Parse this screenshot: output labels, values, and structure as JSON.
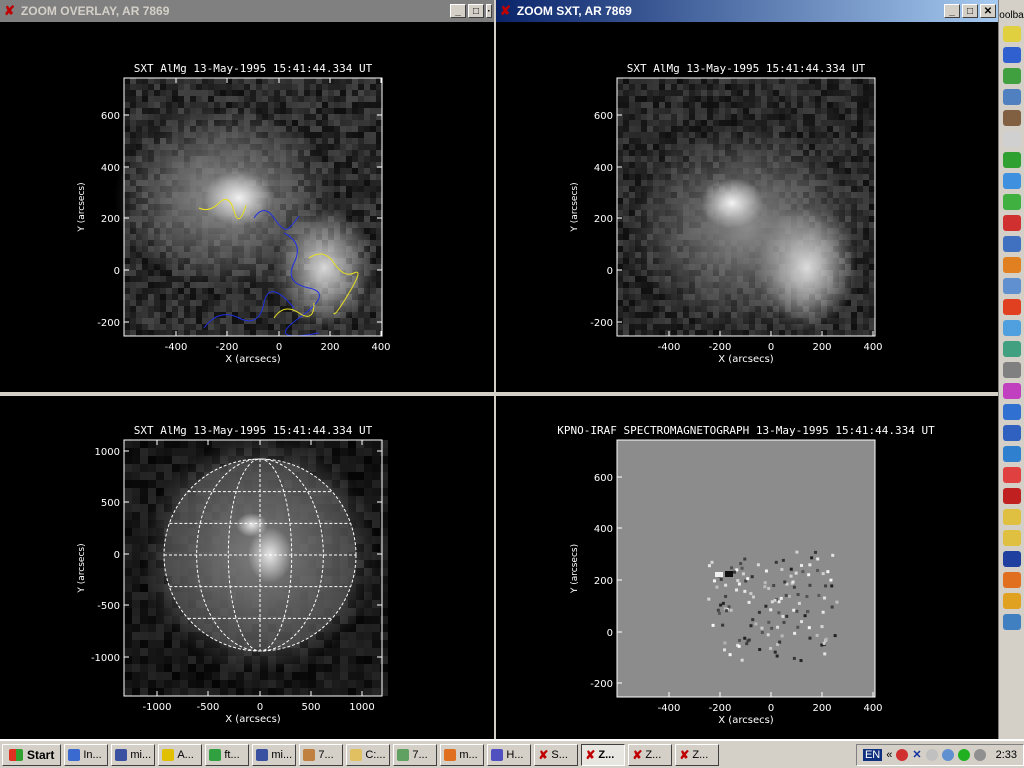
{
  "windows": {
    "left": {
      "title": "ZOOM OVERLAY, AR 7869"
    },
    "right": {
      "title": "ZOOM SXT, AR 7869"
    }
  },
  "panels": {
    "overlay": {
      "title": "SXT AlMg 13-May-1995 15:41:44.334 UT",
      "xlabel": "X (arcsecs)",
      "ylabel": "Y (arcsecs)",
      "xticks": [
        "-400",
        "-200",
        "0",
        "200",
        "400"
      ],
      "yticks": [
        "600",
        "400",
        "200",
        "0",
        "-200"
      ]
    },
    "sxt_zoom": {
      "title": "SXT AlMg 13-May-1995 15:41:44.334 UT",
      "xlabel": "X (arcsecs)",
      "ylabel": "Y (arcsecs)",
      "xticks": [
        "-400",
        "-200",
        "0",
        "200",
        "400"
      ],
      "yticks": [
        "600",
        "400",
        "200",
        "0",
        "-200"
      ]
    },
    "full_disk": {
      "title": "SXT AlMg 13-May-1995 15:41:44.334 UT",
      "xlabel": "X (arcsecs)",
      "ylabel": "Y (arcsecs)",
      "xticks": [
        "-1000",
        "-500",
        "0",
        "500",
        "1000"
      ],
      "yticks": [
        "1000",
        "500",
        "0",
        "-500",
        "-1000"
      ]
    },
    "magnetogram": {
      "title": "KPNO-IRAF SPECTROMAGNETOGRAPH 13-May-1995 15:41:44.334 UT",
      "xlabel": "X (arcsecs)",
      "ylabel": "Y (arcsecs)",
      "xticks": [
        "-400",
        "-200",
        "0",
        "200",
        "400"
      ],
      "yticks": [
        "600",
        "400",
        "200",
        "0",
        "-200"
      ]
    }
  },
  "toolbar": {
    "title": "oolba"
  },
  "taskbar": {
    "start": "Start",
    "tasks": [
      {
        "label": "In...",
        "color": "#3a6ad0"
      },
      {
        "label": "mi...",
        "color": "#3a50a0"
      },
      {
        "label": "A...",
        "color": "#e0c000"
      },
      {
        "label": "ft...",
        "color": "#30a040"
      },
      {
        "label": "mi...",
        "color": "#3a50a0"
      },
      {
        "label": "7...",
        "color": "#c08040"
      },
      {
        "label": "C:...",
        "color": "#e0c060"
      },
      {
        "label": "7...",
        "color": "#60a060"
      },
      {
        "label": "m...",
        "color": "#e07020"
      },
      {
        "label": "H...",
        "color": "#5050c0"
      },
      {
        "label": "S...",
        "x": true
      },
      {
        "label": "Z...",
        "x": true,
        "pressed": true
      },
      {
        "label": "Z...",
        "x": true
      },
      {
        "label": "Z...",
        "x": true
      }
    ],
    "tray_lang": "EN",
    "clock": "2:33"
  }
}
